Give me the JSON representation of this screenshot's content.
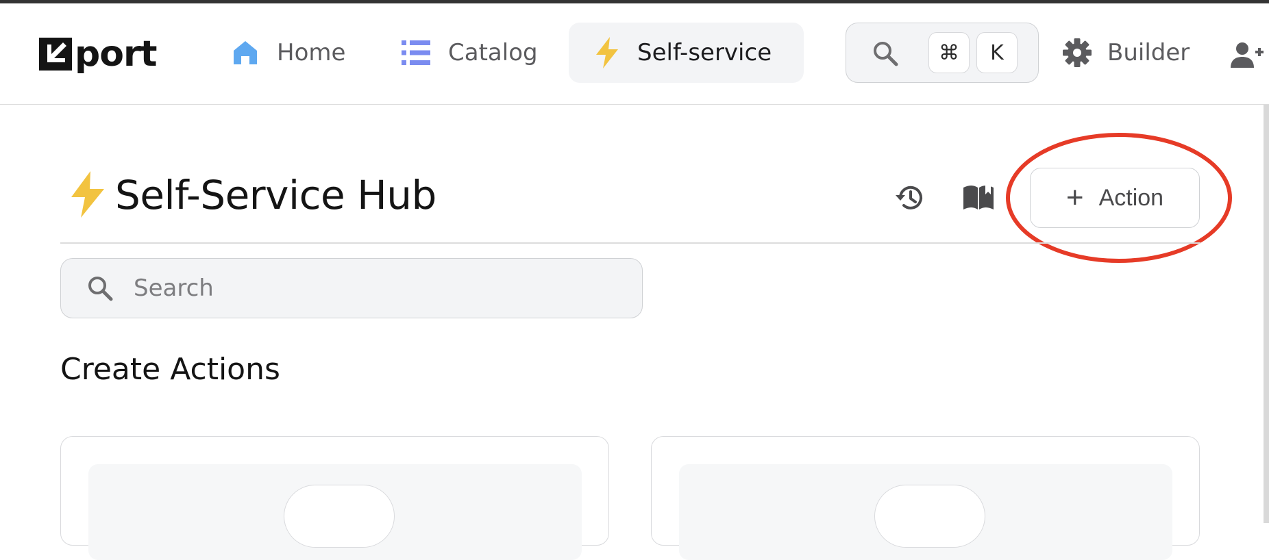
{
  "nav": {
    "logo_text": "port",
    "items": [
      {
        "label": "Home",
        "icon": "home-icon"
      },
      {
        "label": "Catalog",
        "icon": "list-icon"
      },
      {
        "label": "Self-service",
        "icon": "lightning-icon",
        "active": true
      }
    ],
    "search": {
      "icon": "search-icon",
      "shortcut_keys": [
        "⌘",
        "K"
      ]
    },
    "builder_label": "Builder",
    "invite_icon": "add-user-icon"
  },
  "header": {
    "title": "Self-Service Hub",
    "title_icon": "lightning-icon",
    "history_icon": "history-icon",
    "docs_icon": "open-book-icon",
    "add_action": {
      "plus": "+",
      "label": "Action"
    }
  },
  "search": {
    "placeholder": "Search",
    "value": ""
  },
  "section": {
    "title": "Create Actions"
  },
  "cards_count": 2,
  "colors": {
    "accent_yellow": "#f2c340",
    "home_blue": "#5ea8f0",
    "catalog_purple": "#7b8cf0",
    "annotation_red": "#e63b27",
    "active_nav_bg": "#f3f4f6"
  }
}
